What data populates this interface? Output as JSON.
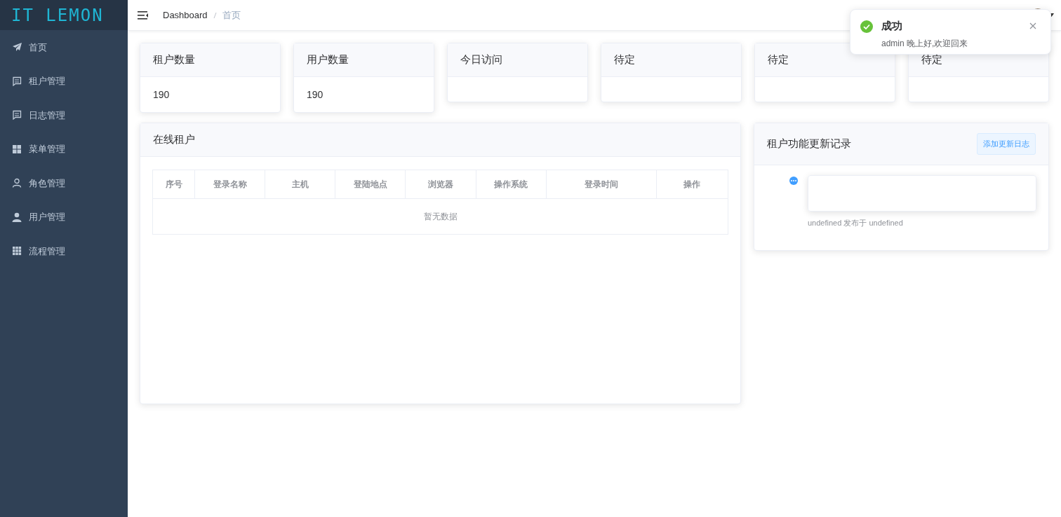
{
  "logo": "IT LEMON",
  "sidebar": {
    "items": [
      {
        "label": "首页",
        "selected": false
      },
      {
        "label": "租户管理",
        "selected": false
      },
      {
        "label": "日志管理",
        "selected": false
      },
      {
        "label": "菜单管理",
        "selected": false
      },
      {
        "label": "角色管理",
        "selected": false
      },
      {
        "label": "用户管理",
        "selected": false
      },
      {
        "label": "流程管理",
        "selected": false
      }
    ]
  },
  "breadcrumb": [
    "Dashboard",
    "首页"
  ],
  "stat_cards": [
    {
      "title": "租户数量",
      "value": "190"
    },
    {
      "title": "用户数量",
      "value": "190"
    },
    {
      "title": "今日访问"
    },
    {
      "title": "待定"
    },
    {
      "title": "待定"
    },
    {
      "title": "待定"
    }
  ],
  "online_panel": {
    "title": "在线租户",
    "table": {
      "columns": [
        "序号",
        "登录名称",
        "主机",
        "登陆地点",
        "浏览器",
        "操作系统",
        "登录时间",
        "操作"
      ],
      "empty_text": "暂无数据"
    }
  },
  "updates_panel": {
    "title": "租户功能更新记录",
    "button": "添加更新日志",
    "entries": [
      {
        "meta": "undefined 发布于 undefined"
      }
    ]
  },
  "toast": {
    "title": "成功",
    "message": "admin 晚上好,欢迎回来"
  }
}
